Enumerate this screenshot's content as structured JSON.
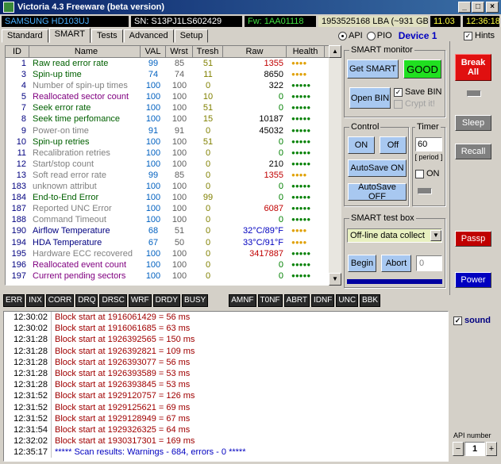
{
  "window": {
    "title": "Victoria 4.3 Freeware (beta version)",
    "min": "_",
    "max": "□",
    "close": "×"
  },
  "info": {
    "model": "SAMSUNG HD103UJ",
    "serial": "SN: S13PJ1LS602429",
    "firmware": "Fw: 1AA01118",
    "lba": "1953525168 LBA (~931 GB)",
    "date": "11.03",
    "time": "12:36:18"
  },
  "tabs": [
    "Standard",
    "SMART",
    "Tests",
    "Advanced",
    "Setup"
  ],
  "api": {
    "api_label": "API",
    "pio_label": "PIO",
    "device": "Device 1",
    "hints": "Hints"
  },
  "smart_table": {
    "headers": [
      "ID",
      "Name",
      "VAL",
      "Wrst",
      "Tresh",
      "Raw",
      "Health"
    ],
    "rows": [
      {
        "id": "1",
        "name": "Raw read error rate",
        "val": "99",
        "wrst": "85",
        "tresh": "51",
        "raw": "1355",
        "health": "●●●●",
        "nc": "#006000",
        "hc": "#e0a000",
        "vc": "#0060c0",
        "rc": "#c00000"
      },
      {
        "id": "3",
        "name": "Spin-up time",
        "val": "74",
        "wrst": "74",
        "tresh": "11",
        "raw": "8650",
        "health": "●●●●",
        "nc": "#006000",
        "hc": "#e0a000",
        "vc": "#0060c0",
        "rc": "#000000"
      },
      {
        "id": "4",
        "name": "Number of spin-up times",
        "val": "100",
        "wrst": "100",
        "tresh": "0",
        "raw": "322",
        "health": "●●●●●",
        "nc": "#808080",
        "hc": "#008000",
        "vc": "#0060c0",
        "rc": "#000000"
      },
      {
        "id": "5",
        "name": "Reallocated sector count",
        "val": "100",
        "wrst": "100",
        "tresh": "10",
        "raw": "0",
        "health": "●●●●●",
        "nc": "#800080",
        "hc": "#008000",
        "vc": "#0060c0",
        "rc": "#008000"
      },
      {
        "id": "7",
        "name": "Seek error rate",
        "val": "100",
        "wrst": "100",
        "tresh": "51",
        "raw": "0",
        "health": "●●●●●",
        "nc": "#006000",
        "hc": "#008000",
        "vc": "#0060c0",
        "rc": "#008000"
      },
      {
        "id": "8",
        "name": "Seek time perfomance",
        "val": "100",
        "wrst": "100",
        "tresh": "15",
        "raw": "10187",
        "health": "●●●●●",
        "nc": "#006000",
        "hc": "#008000",
        "vc": "#0060c0",
        "rc": "#000000"
      },
      {
        "id": "9",
        "name": "Power-on time",
        "val": "91",
        "wrst": "91",
        "tresh": "0",
        "raw": "45032",
        "health": "●●●●●",
        "nc": "#808080",
        "hc": "#008000",
        "vc": "#0060c0",
        "rc": "#000000"
      },
      {
        "id": "10",
        "name": "Spin-up retries",
        "val": "100",
        "wrst": "100",
        "tresh": "51",
        "raw": "0",
        "health": "●●●●●",
        "nc": "#006000",
        "hc": "#008000",
        "vc": "#0060c0",
        "rc": "#008000"
      },
      {
        "id": "11",
        "name": "Recalibration retries",
        "val": "100",
        "wrst": "100",
        "tresh": "0",
        "raw": "0",
        "health": "●●●●●",
        "nc": "#808080",
        "hc": "#008000",
        "vc": "#0060c0",
        "rc": "#008000"
      },
      {
        "id": "12",
        "name": "Start/stop count",
        "val": "100",
        "wrst": "100",
        "tresh": "0",
        "raw": "210",
        "health": "●●●●●",
        "nc": "#808080",
        "hc": "#008000",
        "vc": "#0060c0",
        "rc": "#000000"
      },
      {
        "id": "13",
        "name": "Soft read error rate",
        "val": "99",
        "wrst": "85",
        "tresh": "0",
        "raw": "1355",
        "health": "●●●●",
        "nc": "#808080",
        "hc": "#e0a000",
        "vc": "#0060c0",
        "rc": "#c00000"
      },
      {
        "id": "183",
        "name": "unknown attribut",
        "val": "100",
        "wrst": "100",
        "tresh": "0",
        "raw": "0",
        "health": "●●●●●",
        "nc": "#808080",
        "hc": "#008000",
        "vc": "#0060c0",
        "rc": "#008000"
      },
      {
        "id": "184",
        "name": "End-to-End Error",
        "val": "100",
        "wrst": "100",
        "tresh": "99",
        "raw": "0",
        "health": "●●●●●",
        "nc": "#006000",
        "hc": "#008000",
        "vc": "#0060c0",
        "rc": "#008000"
      },
      {
        "id": "187",
        "name": "Reported UNC Error",
        "val": "100",
        "wrst": "100",
        "tresh": "0",
        "raw": "6087",
        "health": "●●●●●",
        "nc": "#808080",
        "hc": "#008000",
        "vc": "#0060c0",
        "rc": "#c00000"
      },
      {
        "id": "188",
        "name": "Command Timeout",
        "val": "100",
        "wrst": "100",
        "tresh": "0",
        "raw": "0",
        "health": "●●●●●",
        "nc": "#808080",
        "hc": "#008000",
        "vc": "#0060c0",
        "rc": "#008000"
      },
      {
        "id": "190",
        "name": "Airflow Temperature",
        "val": "68",
        "wrst": "51",
        "tresh": "0",
        "raw": "32°C/89°F",
        "health": "●●●●",
        "nc": "#000080",
        "hc": "#e0a000",
        "vc": "#0060c0",
        "rc": "#0000c0"
      },
      {
        "id": "194",
        "name": "HDA Temperature",
        "val": "67",
        "wrst": "50",
        "tresh": "0",
        "raw": "33°C/91°F",
        "health": "●●●●",
        "nc": "#000080",
        "hc": "#e0a000",
        "vc": "#0060c0",
        "rc": "#0000c0"
      },
      {
        "id": "195",
        "name": "Hardware ECC recovered",
        "val": "100",
        "wrst": "100",
        "tresh": "0",
        "raw": "3417887",
        "health": "●●●●●",
        "nc": "#808080",
        "hc": "#008000",
        "vc": "#0060c0",
        "rc": "#c00000"
      },
      {
        "id": "196",
        "name": "Reallocated event count",
        "val": "100",
        "wrst": "100",
        "tresh": "0",
        "raw": "0",
        "health": "●●●●●",
        "nc": "#800080",
        "hc": "#008000",
        "vc": "#0060c0",
        "rc": "#008000"
      },
      {
        "id": "197",
        "name": "Current pending sectors",
        "val": "100",
        "wrst": "100",
        "tresh": "0",
        "raw": "0",
        "health": "●●●●●",
        "nc": "#800080",
        "hc": "#008000",
        "vc": "#0060c0",
        "rc": "#008000"
      }
    ]
  },
  "smart_monitor": {
    "title": "SMART monitor",
    "get_smart": "Get SMART",
    "status": "GOOD",
    "open_bin": "Open BIN",
    "save_bin": "Save BIN",
    "crypt": "Crypt it!"
  },
  "control": {
    "title": "Control",
    "on": "ON",
    "off": "Off",
    "autosave_on": "AutoSave ON",
    "autosave_off": "AutoSave OFF"
  },
  "timer": {
    "title": "Timer",
    "value": "60",
    "period": "[ period ]",
    "on": "ON"
  },
  "test_box": {
    "title": "SMART test box",
    "select": "Off-line data collect",
    "begin": "Begin",
    "abort": "Abort",
    "value": "0"
  },
  "side": {
    "break": "Break All",
    "sleep": "Sleep",
    "recall": "Recall",
    "passp": "Passp",
    "power": "Power",
    "sound": "sound",
    "api_number": "API number",
    "api_value": "1",
    "minus": "−",
    "plus": "+"
  },
  "status_left": [
    "ERR",
    "INX",
    "CORR",
    "DRQ",
    "DRSC",
    "WRF",
    "DRDY",
    "BUSY"
  ],
  "status_right": [
    "AMNF",
    "T0NF",
    "ABRT",
    "IDNF",
    "UNC",
    "BBK"
  ],
  "log": [
    {
      "t": "12:30:02",
      "m": "Block start at 1916061429 = 56 ms"
    },
    {
      "t": "12:30:02",
      "m": "Block start at 1916061685 = 63 ms"
    },
    {
      "t": "12:31:28",
      "m": "Block start at 1926392565 = 150 ms"
    },
    {
      "t": "12:31:28",
      "m": "Block start at 1926392821 = 109 ms"
    },
    {
      "t": "12:31:28",
      "m": "Block start at 1926393077 = 56 ms"
    },
    {
      "t": "12:31:28",
      "m": "Block start at 1926393589 = 53 ms"
    },
    {
      "t": "12:31:28",
      "m": "Block start at 1926393845 = 53 ms"
    },
    {
      "t": "12:31:52",
      "m": "Block start at 1929120757 = 126 ms"
    },
    {
      "t": "12:31:52",
      "m": "Block start at 1929125621 = 69 ms"
    },
    {
      "t": "12:31:52",
      "m": "Block start at 1929128949 = 67 ms"
    },
    {
      "t": "12:31:54",
      "m": "Block start at 1929326325 = 64 ms"
    },
    {
      "t": "12:32:02",
      "m": "Block start at 1930317301 = 169 ms"
    },
    {
      "t": "12:35:17",
      "m": "***** Scan results: Warnings - 684, errors - 0 *****",
      "final": true
    }
  ]
}
